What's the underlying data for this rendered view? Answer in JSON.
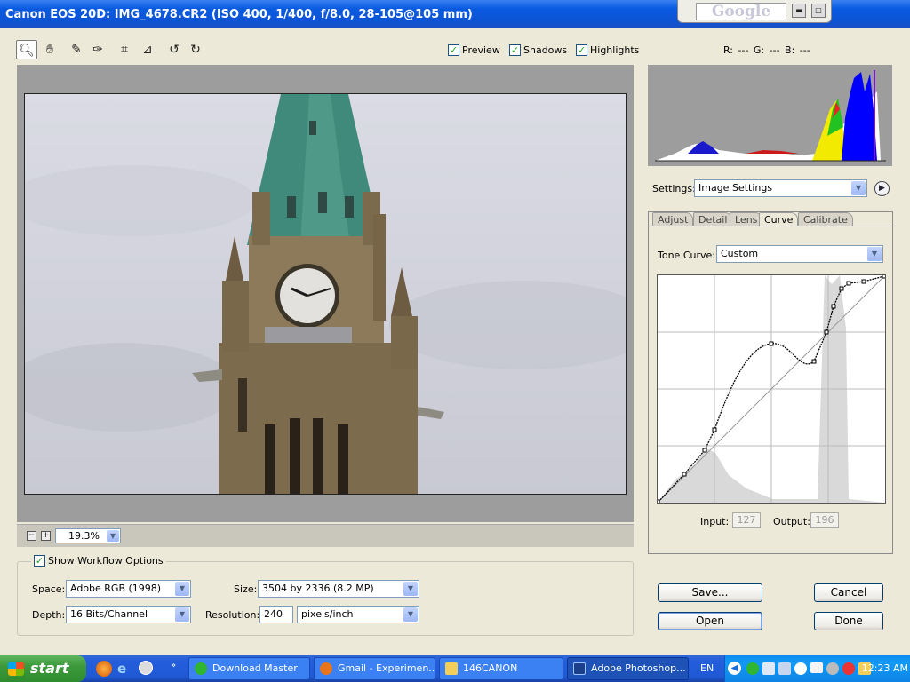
{
  "titlebar": {
    "title": "Canon EOS 20D:  IMG_4678.CR2  (ISO 400, 1/400, f/8.0, 28-105@105 mm)"
  },
  "google_toolbar": {
    "logo_text": "Google"
  },
  "toolbar": {
    "tools": [
      "zoom-tool",
      "hand-tool",
      "white-balance-tool",
      "color-sampler-tool",
      "crop-tool",
      "straighten-tool",
      "rotate-left",
      "rotate-right"
    ],
    "preview_label": "Preview",
    "shadows_label": "Shadows",
    "highlights_label": "Highlights",
    "preview_checked": true,
    "shadows_checked": true,
    "highlights_checked": true
  },
  "rgb_readout": "R: ---    G: ---    B: ---",
  "zoom": {
    "minus": "−",
    "plus": "+",
    "value": "19.3%"
  },
  "settings": {
    "label": "Settings:",
    "value": "Image Settings"
  },
  "tabs": [
    {
      "label": "Adjust",
      "active": false
    },
    {
      "label": "Detail",
      "active": false
    },
    {
      "label": "Lens",
      "active": false
    },
    {
      "label": "Curve",
      "active": true
    },
    {
      "label": "Calibrate",
      "active": false
    }
  ],
  "tone_curve": {
    "label": "Tone Curve:",
    "value": "Custom"
  },
  "curve_io": {
    "input_label": "Input:",
    "input_value": "127",
    "output_label": "Output:",
    "output_value": "196"
  },
  "workflow": {
    "show_label": "Show Workflow Options",
    "show_checked": true,
    "space_label": "Space:",
    "space_value": "Adobe RGB (1998)",
    "depth_label": "Depth:",
    "depth_value": "16 Bits/Channel",
    "size_label": "Size:",
    "size_value": "3504 by 2336  (8.2 MP)",
    "resolution_label": "Resolution:",
    "resolution_value": "240",
    "resolution_unit": "pixels/inch"
  },
  "buttons": {
    "save": "Save...",
    "cancel": "Cancel",
    "open": "Open",
    "done": "Done"
  },
  "taskbar": {
    "start": "start",
    "tasks": [
      {
        "label": "Download Master",
        "active": false
      },
      {
        "label": "Gmail - Experimen...",
        "active": false
      },
      {
        "label": "146CANON",
        "active": false
      },
      {
        "label": "Adobe Photoshop...",
        "active": true
      }
    ],
    "lang": "EN",
    "clock": "12:23 AM"
  },
  "colors": {
    "title_blue": "#0D54D6",
    "curve_line": "#000000",
    "histogram_yellow": "#F2EA00",
    "histogram_blue": "#0000FF"
  }
}
